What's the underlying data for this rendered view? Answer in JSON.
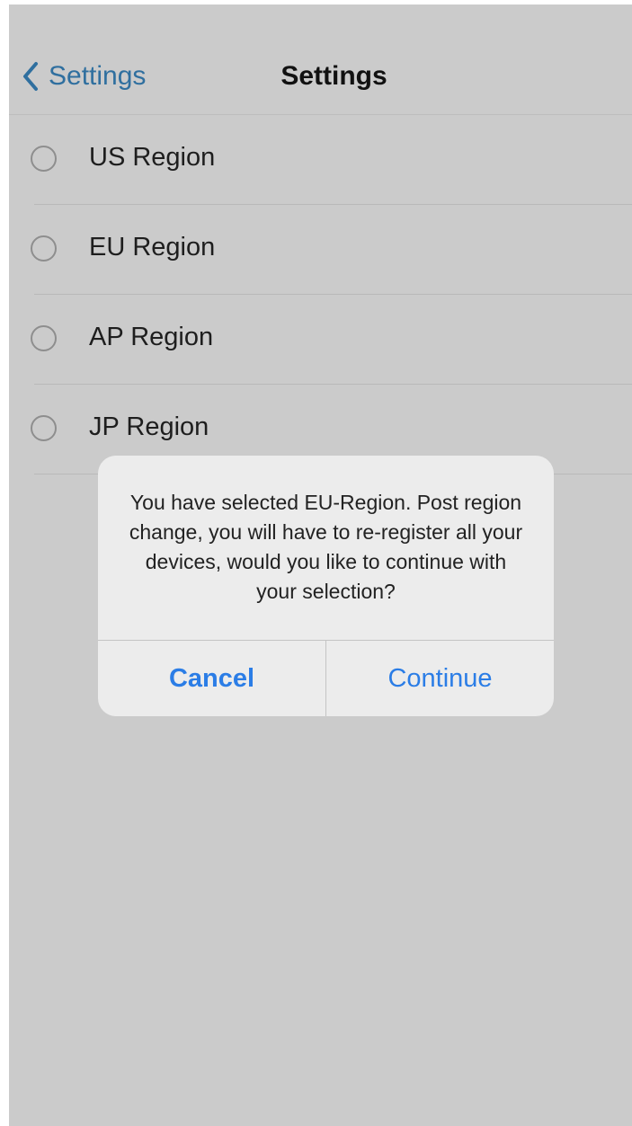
{
  "navbar": {
    "back_label": "Settings",
    "title": "Settings"
  },
  "regions": [
    {
      "label": "US Region",
      "selected": false
    },
    {
      "label": "EU Region",
      "selected": false
    },
    {
      "label": "AP Region",
      "selected": false
    },
    {
      "label": "JP Region",
      "selected": false
    }
  ],
  "dialog": {
    "message": "You have selected EU-Region. Post region change, you will have to re-register all your devices, would you like to continue with your selection?",
    "cancel_label": "Cancel",
    "continue_label": "Continue"
  },
  "colors": {
    "accent": "#2b7de6",
    "back_link": "#2f6f9f",
    "background": "#cbcbcb",
    "dialog_background": "#ececec"
  },
  "icons": {
    "back": "chevron-left-icon",
    "radio": "radio-unselected-icon"
  }
}
